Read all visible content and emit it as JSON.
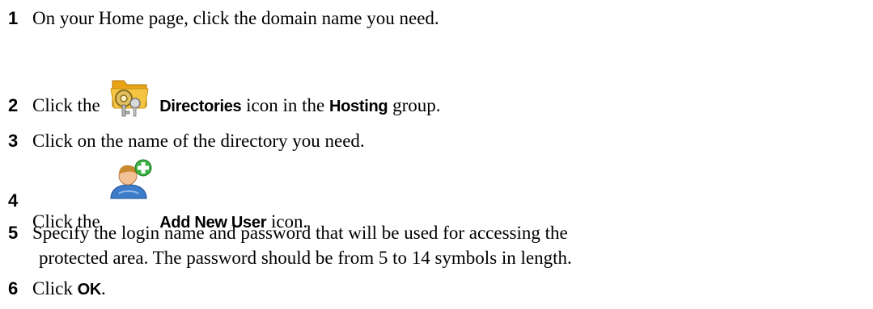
{
  "steps": [
    {
      "number": "1",
      "text": "On your Home page, click the domain name you need."
    },
    {
      "number": "2",
      "before": "Click the",
      "icon": "directories-icon",
      "ui_label": "Directories",
      "middle": "icon in the",
      "group_label": "Hosting",
      "after": "group."
    },
    {
      "number": "3",
      "text": "Click on the name of the directory you need."
    },
    {
      "number": "4",
      "before": "Click the",
      "icon": "add-new-user-icon",
      "ui_label": "Add New User",
      "after": "icon."
    },
    {
      "number": "5",
      "line1": "Specify the login name and password that will be used for accessing the",
      "line2": "protected area. The password should be from 5 to 14 symbols in length."
    },
    {
      "number": "6",
      "before": "Click",
      "ui_label": "OK",
      "after": "."
    }
  ],
  "colors": {
    "text": "#000000",
    "background": "#ffffff",
    "folder_yellow": "#f5c542",
    "user_blue": "#3d7cc9",
    "plus_green": "#3cb043"
  }
}
